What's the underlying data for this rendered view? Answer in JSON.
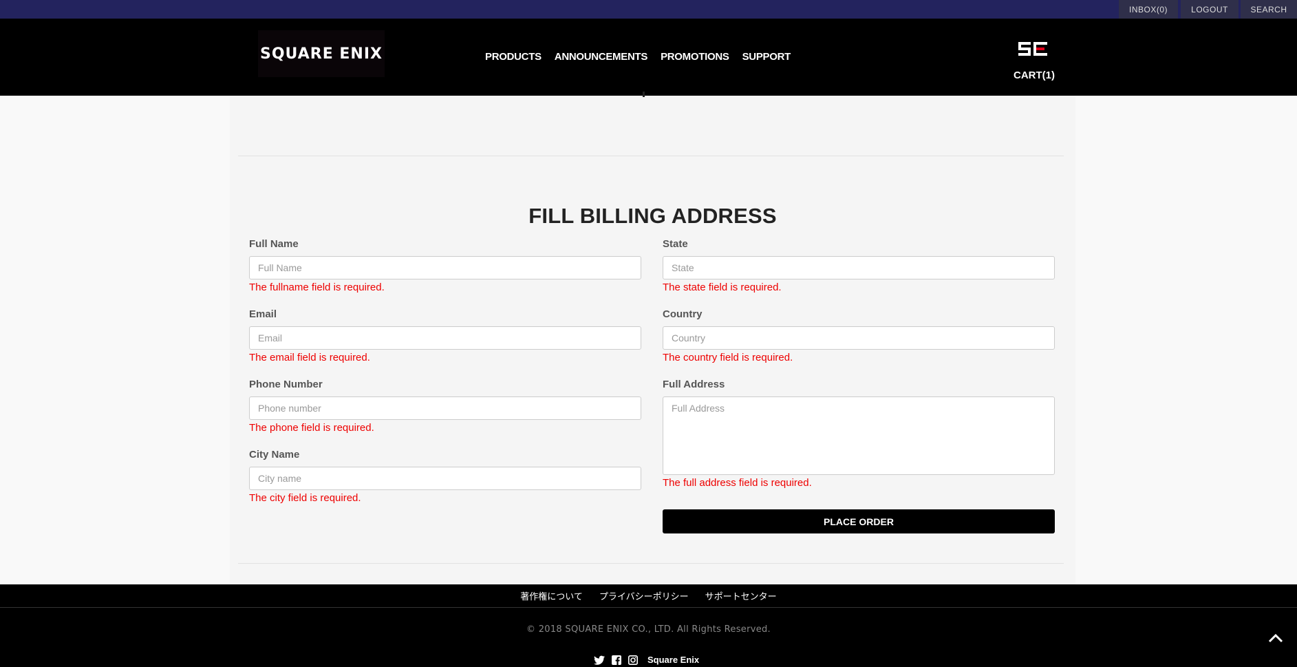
{
  "topbar": {
    "inbox_label": "INBOX(0)",
    "logout_label": "LOGOUT",
    "search_label": "SEARCH"
  },
  "header": {
    "logo_text": "SQUARE ENIX",
    "nav": [
      "PRODUCTS",
      "ANNOUNCEMENTS",
      "PROMOTIONS",
      "SUPPORT"
    ],
    "cart_label": "CART(1)"
  },
  "form": {
    "title": "FILL BILLING ADDRESS",
    "fields": {
      "fullname": {
        "label": "Full Name",
        "placeholder": "Full Name",
        "value": "",
        "error": "The fullname field is required."
      },
      "email": {
        "label": "Email",
        "placeholder": "Email",
        "value": "",
        "error": "The email field is required."
      },
      "phone": {
        "label": "Phone Number",
        "placeholder": "Phone number",
        "value": "",
        "error": "The phone field is required."
      },
      "city": {
        "label": "City Name",
        "placeholder": "City name",
        "value": "",
        "error": "The city field is required."
      },
      "state": {
        "label": "State",
        "placeholder": "State",
        "value": "",
        "error": "The state field is required."
      },
      "country": {
        "label": "Country",
        "placeholder": "Country",
        "value": "",
        "error": "The country field is required."
      },
      "address": {
        "label": "Full Address",
        "placeholder": "Full Address",
        "value": "",
        "error": "The full address field is required."
      }
    },
    "submit_label": "PLACE ORDER"
  },
  "footer": {
    "links": [
      "著作権について",
      "プライバシーポリシー",
      "サポートセンター"
    ],
    "copyright": "© 2018 SQUARE ENIX CO., LTD. All Rights Reserved.",
    "brand": "Square Enix"
  },
  "colors": {
    "topbar": "#23235e",
    "header": "#000000",
    "error": "#ee0000",
    "accent_red": "#e0001a"
  }
}
